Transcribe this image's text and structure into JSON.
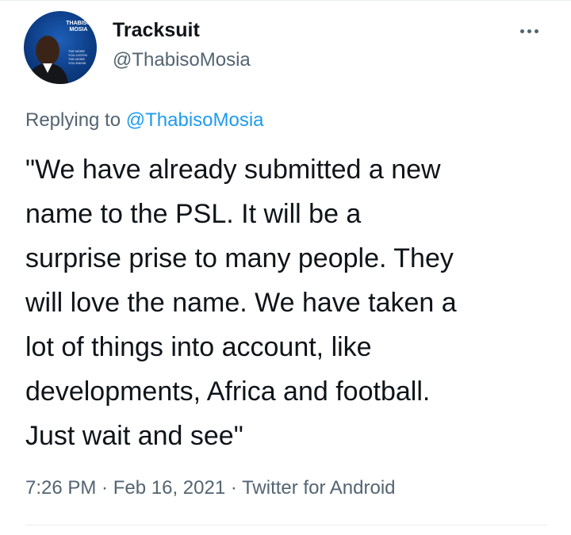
{
  "tweet": {
    "author": {
      "name": "Tracksuit",
      "handle": "@ThabisoMosia",
      "avatar_text": {
        "brand": "THABISO MOSIA",
        "slogan": "THE MORE YOU LISTEN THE MORE YOU KNOW"
      }
    },
    "reply": {
      "prefix": "Replying to ",
      "handle": "@ThabisoMosia"
    },
    "body": "\"We have already submitted a new\nname to the PSL. It will be a\nsurprise prise to many people. They\nwill love the name. We have taken a\nlot of things into account, like\ndevelopments, Africa and football.\nJust wait and see\"",
    "meta": {
      "time": "7:26 PM",
      "sep1": " · ",
      "date": "Feb 16, 2021",
      "sep2": " · ",
      "source": "Twitter for Android"
    }
  },
  "icons": {
    "more": "more-horizontal-icon"
  },
  "colors": {
    "link": "#1d9bf0",
    "secondary_text": "#536471",
    "primary_text": "#0f1419"
  }
}
